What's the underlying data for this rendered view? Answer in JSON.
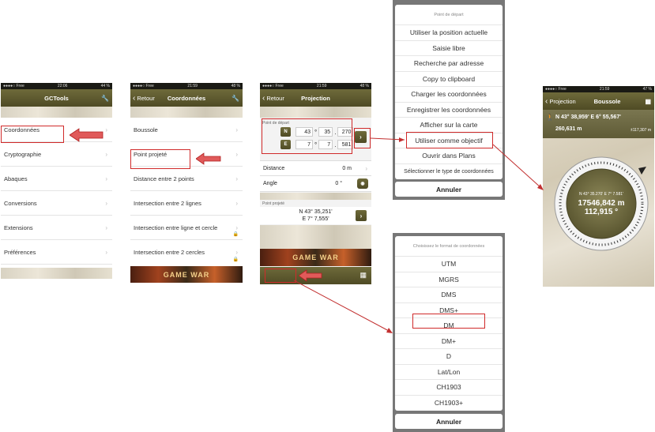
{
  "screen1": {
    "status": {
      "carrier": "●●●●○ Free",
      "time": "22:06",
      "battery": "44 %"
    },
    "title": "GCTools",
    "items": [
      "Coordonnées",
      "Cryptographie",
      "Abaques",
      "Conversions",
      "Extensions",
      "Préférences"
    ]
  },
  "screen2": {
    "status": {
      "carrier": "●●●●○ Free",
      "time": "21:59",
      "battery": "48 %"
    },
    "back": "Retour",
    "title": "Coordonnées",
    "items": [
      "Boussole",
      "Point projeté",
      "Distance entre 2 points",
      "Intersection entre 2 lignes",
      "Intersection entre ligne et cercle",
      "Intersection entre 2 cercles"
    ],
    "ad": "GAME WAR"
  },
  "screen3": {
    "status": {
      "carrier": "●●●●○ Free",
      "time": "21:59",
      "battery": "48 %"
    },
    "back": "Retour",
    "title": "Projection",
    "start_label": "Point de départ",
    "n_label": "N",
    "e_label": "E",
    "n_vals": [
      "43",
      "35",
      "270"
    ],
    "e_vals": [
      "7",
      "7",
      "581"
    ],
    "deg": "°",
    "sep": ".",
    "distance_label": "Distance",
    "distance_val": "0 m",
    "angle_label": "Angle",
    "angle_val": "0 °",
    "proj_label": "Point projeté",
    "proj_n": "N 43° 35,251'",
    "proj_e": "E 7° 7,555'",
    "ad": "GAME WAR"
  },
  "sheet1": {
    "status_time": "21:59",
    "header": "Point de départ",
    "options": [
      "Utiliser la position actuelle",
      "Saisie libre",
      "Recherche par adresse",
      "Copy to clipboard",
      "Charger les coordonnées",
      "Enregistrer les coordonnées",
      "Afficher sur la carte",
      "Utiliser comme objectif",
      "Ouvrir dans Plans",
      "Sélectionner le type de coordonnées"
    ],
    "cancel": "Annuler"
  },
  "sheet2": {
    "header": "Choisissez le format de coordonnées",
    "options": [
      "UTM",
      "MGRS",
      "DMS",
      "DMS+",
      "DM",
      "DM+",
      "D",
      "Lat/Lon",
      "CH1903",
      "CH1903+"
    ],
    "cancel": "Annuler"
  },
  "screen5": {
    "status": {
      "carrier": "●●●●○ Free",
      "time": "21:59",
      "battery": "47 %"
    },
    "back": "Projection",
    "title": "Boussole",
    "coord": "N 43° 38,959' E 6° 55,567'",
    "dist_small": "260,631 m",
    "accuracy": "±117,307 m",
    "center_coord": "N 43° 35.270' E 7° 7.581'",
    "distance": "17546,842 m",
    "bearing": "112,915 °"
  },
  "colors": {
    "accent_red": "#d02a2a",
    "olive": "#5a5630"
  }
}
